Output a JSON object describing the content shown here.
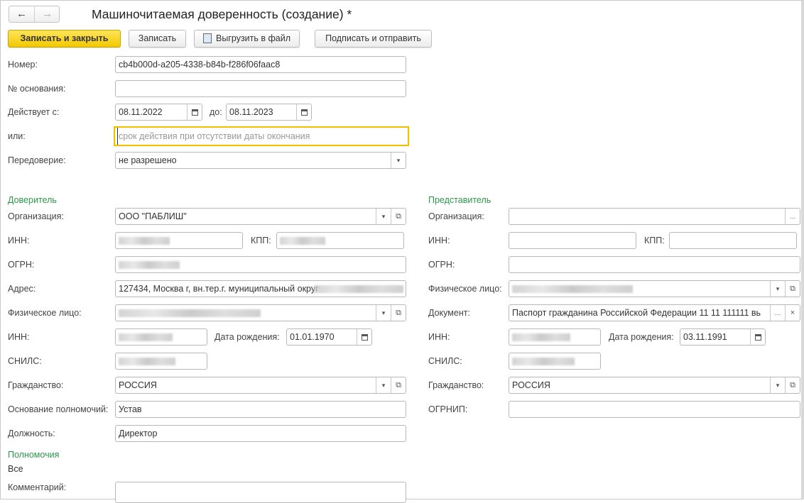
{
  "window": {
    "title": "Машиночитаемая доверенность (создание) *"
  },
  "toolbar": {
    "save_close": "Записать и закрыть",
    "save": "Записать",
    "export": "Выгрузить в файл",
    "sign_send": "Подписать и отправить"
  },
  "colors": {
    "accent": "#f2c800",
    "group_title": "#2a9a4a",
    "focus_border": "#f0c000"
  },
  "form": {
    "number": {
      "label": "Номер:",
      "value": "cb4b000d-a205-4338-b84b-f286f06faac8"
    },
    "basis_number": {
      "label": "№ основания:",
      "value": ""
    },
    "valid_from": {
      "label": "Действует с:",
      "value": "08.11.2022"
    },
    "valid_to": {
      "label": "до:",
      "value": "08.11.2023"
    },
    "or": {
      "label": "или:",
      "placeholder": "срок действия при отсутствии даты окончания"
    },
    "redelegation": {
      "label": "Передоверие:",
      "value": "не разрешено"
    }
  },
  "principal": {
    "title": "Доверитель",
    "organization": {
      "label": "Организация:",
      "value": "ООО \"ПАБЛИШ\""
    },
    "inn": {
      "label": "ИНН:"
    },
    "kpp": {
      "label": "КПП:"
    },
    "ogrn": {
      "label": "ОГРН:"
    },
    "address": {
      "label": "Адрес:",
      "value": "127434, Москва г, вн.тер.г. муниципальный округ"
    },
    "person": {
      "label": "Физическое лицо:"
    },
    "person_inn": {
      "label": "ИНН:"
    },
    "birth_date": {
      "label": "Дата рождения:",
      "value": "01.01.1970"
    },
    "snils": {
      "label": "СНИЛС:"
    },
    "citizenship": {
      "label": "Гражданство:",
      "value": "РОССИЯ"
    },
    "authority_basis": {
      "label": "Основание полномочий:",
      "value": "Устав"
    },
    "position": {
      "label": "Должность:",
      "value": "Директор"
    },
    "powers_title": "Полномочия",
    "powers_value": "Все",
    "comment": {
      "label": "Комментарий:",
      "value": ""
    }
  },
  "representative": {
    "title": "Представитель",
    "organization": {
      "label": "Организация:",
      "value": ""
    },
    "inn": {
      "label": "ИНН:",
      "value": ""
    },
    "kpp": {
      "label": "КПП:",
      "value": ""
    },
    "ogrn": {
      "label": "ОГРН:",
      "value": ""
    },
    "person": {
      "label": "Физическое лицо:"
    },
    "document": {
      "label": "Документ:",
      "value": "Паспорт гражданина Российской Федерации 11 11 111111 вь"
    },
    "person_inn": {
      "label": "ИНН:"
    },
    "birth_date": {
      "label": "Дата рождения:",
      "value": "03.11.1991"
    },
    "snils": {
      "label": "СНИЛС:"
    },
    "citizenship": {
      "label": "Гражданство:",
      "value": "РОССИЯ"
    },
    "ogrnip": {
      "label": "ОГРНИП:",
      "value": ""
    }
  }
}
